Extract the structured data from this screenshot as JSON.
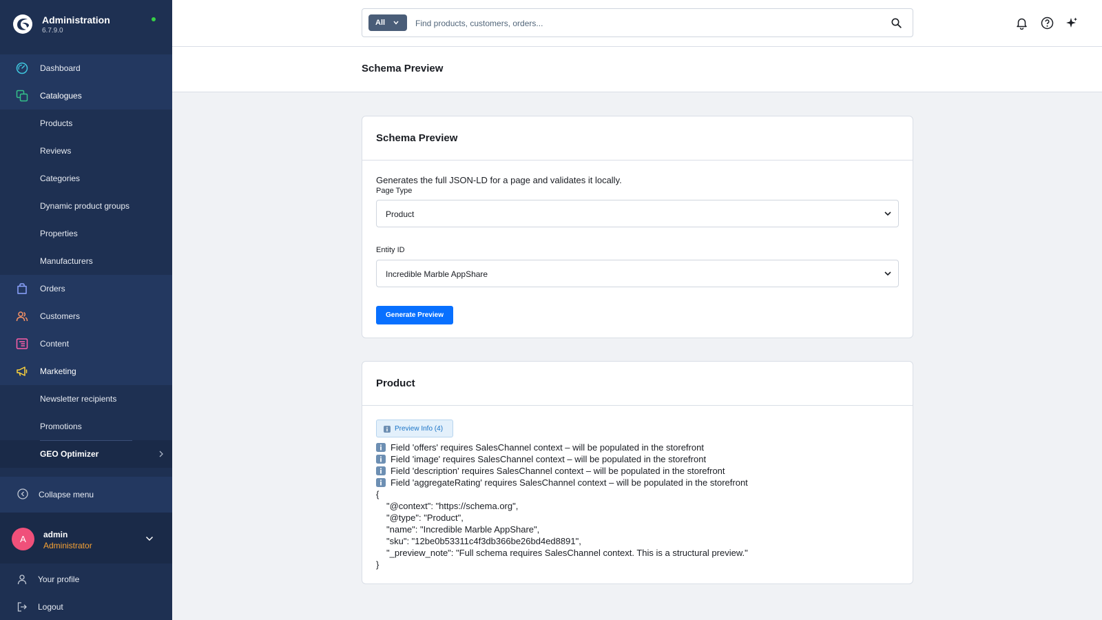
{
  "app": {
    "title": "Administration",
    "version": "6.7.9.0",
    "status_color": "#37d046"
  },
  "sidebar": {
    "items": [
      {
        "label": "Dashboard",
        "icon": "gauge-icon"
      },
      {
        "label": "Catalogues",
        "icon": "catalogue-icon"
      },
      {
        "label": "Products"
      },
      {
        "label": "Reviews"
      },
      {
        "label": "Categories"
      },
      {
        "label": "Dynamic product groups"
      },
      {
        "label": "Properties"
      },
      {
        "label": "Manufacturers"
      },
      {
        "label": "Orders",
        "icon": "shopping-bag-icon"
      },
      {
        "label": "Customers",
        "icon": "users-icon"
      },
      {
        "label": "Content",
        "icon": "content-icon"
      },
      {
        "label": "Marketing",
        "icon": "megaphone-icon"
      },
      {
        "label": "Newsletter recipients"
      },
      {
        "label": "Promotions"
      },
      {
        "label": "GEO Optimizer"
      }
    ],
    "collapse_label": "Collapse menu",
    "user": {
      "initial": "A",
      "name": "admin",
      "role": "Administrator"
    },
    "profile_label": "Your profile",
    "logout_label": "Logout"
  },
  "search": {
    "scope": "All",
    "placeholder": "Find products, customers, orders..."
  },
  "page": {
    "title": "Schema Preview"
  },
  "form_card": {
    "title": "Schema Preview",
    "description": "Generates the full JSON-LD for a page and validates it locally.",
    "page_type_label": "Page Type",
    "page_type_value": "Product",
    "entity_label": "Entity ID",
    "entity_value": "Incredible Marble AppShare",
    "button_label": "Generate Preview"
  },
  "result_card": {
    "title": "Product",
    "badge": "Preview Info (4)",
    "notices": [
      "Field 'offers' requires SalesChannel context – will be populated in the storefront",
      "Field 'image' requires SalesChannel context – will be populated in the storefront",
      "Field 'description' requires SalesChannel context – will be populated in the storefront",
      "Field 'aggregateRating' requires SalesChannel context – will be populated in the storefront"
    ],
    "json_lines": [
      "{",
      "\"@context\": \"https://schema.org\",",
      "\"@type\": \"Product\",",
      "\"name\": \"Incredible Marble AppShare\",",
      "\"sku\": \"12be0b53311c4f3db366be26bd4ed8891\",",
      "\"_preview_note\": \"Full schema requires SalesChannel context. This is a structural preview.\"",
      "}"
    ]
  },
  "colors": {
    "sidebar": "#1e3052",
    "accent": "#0870ff",
    "avatar": "#f0507a",
    "role": "#f7a234"
  }
}
